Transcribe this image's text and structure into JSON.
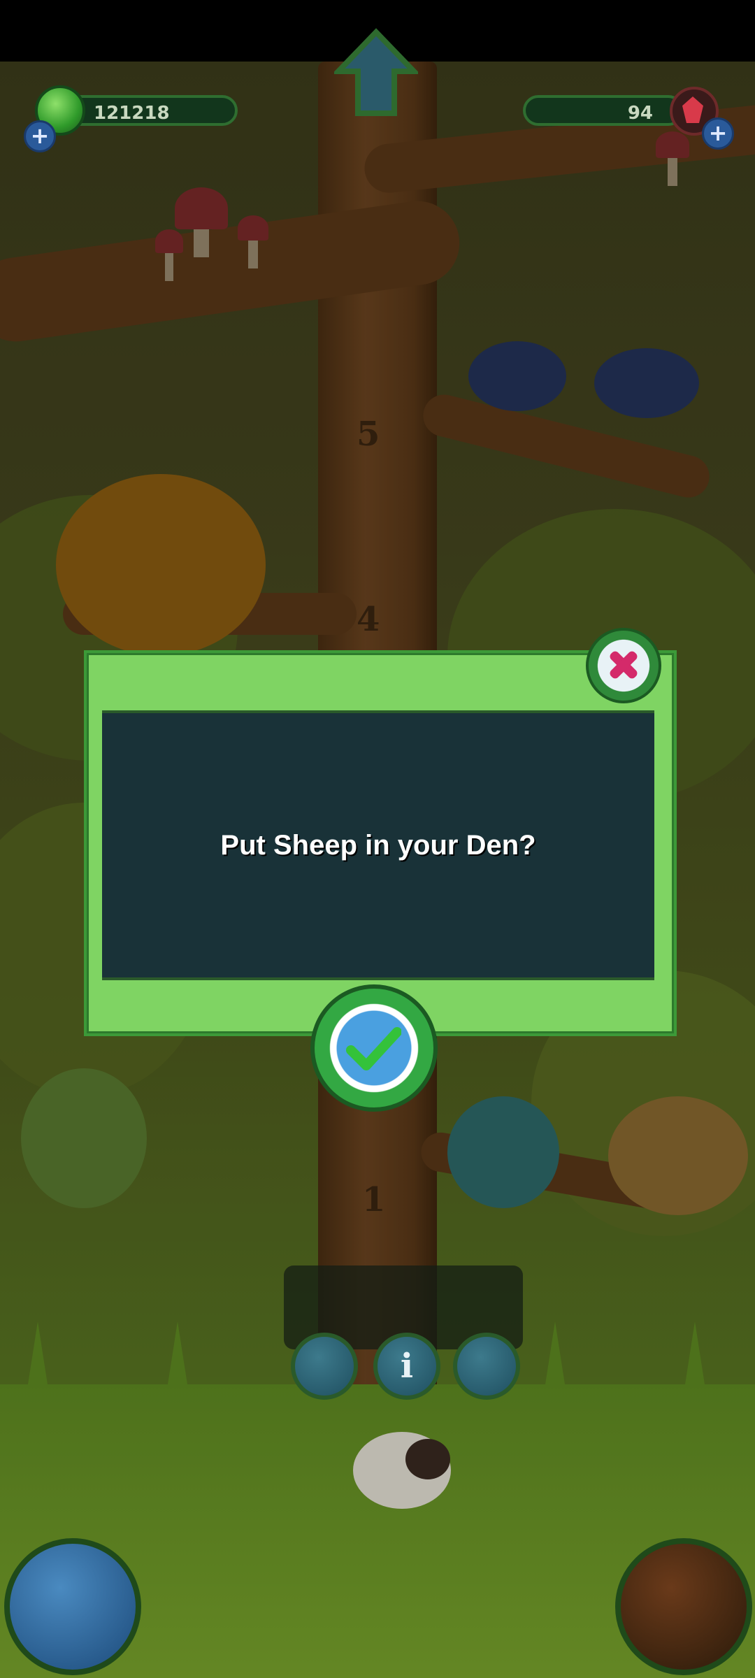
{
  "hud": {
    "coins": "121218",
    "gems": "94"
  },
  "dialog": {
    "message": "Put Sheep in your Den?"
  },
  "tree_numbers": [
    "5",
    "4",
    "1"
  ],
  "icons": {
    "coin": "green-gem-icon",
    "gem": "ruby-icon",
    "add": "plus-icon",
    "home": "home-arrow-icon",
    "close": "close-x-icon",
    "confirm": "checkmark-icon",
    "net": "net-icon",
    "info": "info-icon",
    "den": "den-icon",
    "world": "globe-icon",
    "house": "house-icon"
  },
  "colors": {
    "dialog_frame": "#7fd463",
    "dialog_panel": "#193238",
    "close_accent": "#d42a6a",
    "confirm_check": "#34c23a"
  }
}
